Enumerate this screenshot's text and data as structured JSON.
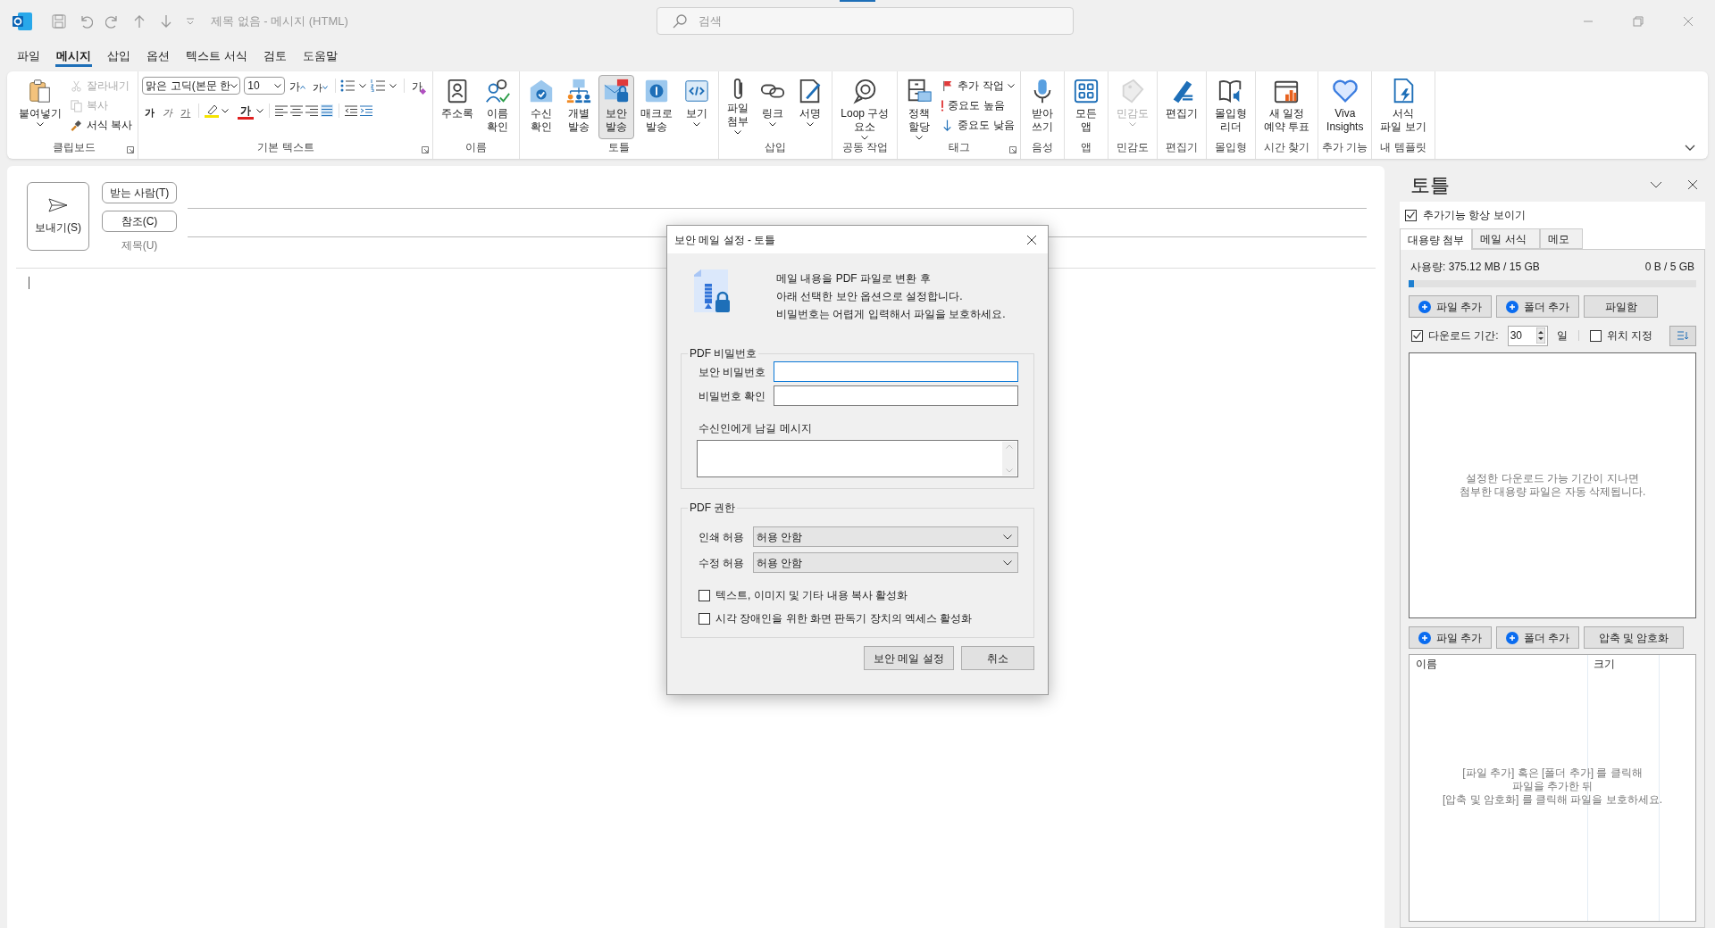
{
  "title_bar": {
    "title": "제목 없음  -  메시지 (HTML)",
    "search_placeholder": "검색"
  },
  "menu_tabs": [
    {
      "label": "파일",
      "selected": false
    },
    {
      "label": "메시지",
      "selected": true
    },
    {
      "label": "삽입",
      "selected": false
    },
    {
      "label": "옵션",
      "selected": false
    },
    {
      "label": "텍스트 서식",
      "selected": false
    },
    {
      "label": "검토",
      "selected": false
    },
    {
      "label": "도움말",
      "selected": false
    }
  ],
  "ribbon": {
    "groups": [
      {
        "label": "클립보드",
        "launcher": true,
        "items": [
          {
            "kind": "large",
            "label": "붙여넣기",
            "dropdown": true,
            "disabled": false,
            "selected": false
          },
          {
            "kind": "stack",
            "items": [
              {
                "label": "잘라내기",
                "disabled": true,
                "dropdown": false
              },
              {
                "label": "복사",
                "disabled": true,
                "dropdown": false
              },
              {
                "label": "서식 복사",
                "disabled": false,
                "dropdown": false
              }
            ]
          }
        ]
      },
      {
        "label": "기본 텍스트",
        "launcher": true,
        "items": [
          {
            "kind": "text_tools",
            "font": "맑은 고딕(본문 한",
            "size": "10",
            "glyphs": [
              {
                "kind": "grow",
                "label": "가"
              },
              {
                "kind": "shrink",
                "label": "가"
              },
              {
                "kind": "clear",
                "label": "가"
              },
              {
                "kind": "bold",
                "label": "가"
              },
              {
                "kind": "italic",
                "label": "가"
              },
              {
                "kind": "underline",
                "label": "가"
              },
              {
                "kind": "font_color",
                "label": "가"
              }
            ]
          }
        ]
      },
      {
        "label": "이름",
        "launcher": false,
        "items": [
          {
            "kind": "large",
            "label": "주소록",
            "dropdown": false,
            "disabled": false,
            "selected": false
          },
          {
            "kind": "large",
            "label": "이름\n확인",
            "dropdown": false,
            "disabled": false,
            "selected": false
          }
        ]
      },
      {
        "label": "토틀",
        "launcher": false,
        "items": [
          {
            "kind": "large",
            "label": "수신\n확인",
            "dropdown": false,
            "disabled": false,
            "selected": false
          },
          {
            "kind": "large",
            "label": "개별\n발송",
            "dropdown": false,
            "disabled": false,
            "selected": false
          },
          {
            "kind": "large",
            "label": "보안\n발송",
            "dropdown": false,
            "disabled": false,
            "selected": true
          },
          {
            "kind": "large",
            "label": "매크로\n발송",
            "dropdown": false,
            "disabled": false,
            "selected": false
          },
          {
            "kind": "large",
            "label": "보기",
            "dropdown": true,
            "disabled": false,
            "selected": false
          }
        ]
      },
      {
        "label": "삽입",
        "launcher": false,
        "items": [
          {
            "kind": "large",
            "label": "파일\n첨부",
            "dropdown": true,
            "disabled": false,
            "selected": false
          },
          {
            "kind": "large",
            "label": "링크",
            "dropdown": true,
            "disabled": false,
            "selected": false
          },
          {
            "kind": "large",
            "label": "서명",
            "dropdown": true,
            "disabled": false,
            "selected": false
          }
        ]
      },
      {
        "label": "공동 작업",
        "launcher": false,
        "items": [
          {
            "kind": "large",
            "label": "Loop 구성\n요소",
            "dropdown": true,
            "disabled": false,
            "selected": false
          }
        ]
      },
      {
        "label": "태그",
        "launcher": true,
        "items": [
          {
            "kind": "large",
            "label": "정책\n할당",
            "dropdown": true,
            "disabled": false,
            "selected": false
          },
          {
            "kind": "stack",
            "items": [
              {
                "label": "추가 작업",
                "disabled": false,
                "dropdown": true
              },
              {
                "label": "중요도 높음",
                "disabled": false,
                "dropdown": false
              },
              {
                "label": "중요도 낮음",
                "disabled": false,
                "dropdown": false
              }
            ]
          }
        ]
      },
      {
        "label": "음성",
        "launcher": false,
        "items": [
          {
            "kind": "large",
            "label": "받아\n쓰기",
            "dropdown": false,
            "disabled": false,
            "selected": false
          }
        ]
      },
      {
        "label": "앱",
        "launcher": false,
        "items": [
          {
            "kind": "large",
            "label": "모든\n앱",
            "dropdown": false,
            "disabled": false,
            "selected": false
          }
        ]
      },
      {
        "label": "민감도",
        "launcher": false,
        "items": [
          {
            "kind": "large",
            "label": "민감도",
            "dropdown": true,
            "disabled": true,
            "selected": false
          }
        ]
      },
      {
        "label": "편집기",
        "launcher": false,
        "items": [
          {
            "kind": "large",
            "label": "편집기",
            "dropdown": false,
            "disabled": false,
            "selected": false
          }
        ]
      },
      {
        "label": "몰입형",
        "launcher": false,
        "items": [
          {
            "kind": "large",
            "label": "몰입형\n리더",
            "dropdown": false,
            "disabled": false,
            "selected": false
          }
        ]
      },
      {
        "label": "시간 찾기",
        "launcher": false,
        "items": [
          {
            "kind": "large",
            "label": "새 일정\n예약 투표",
            "dropdown": false,
            "disabled": false,
            "selected": false
          }
        ]
      },
      {
        "label": "추가 기능",
        "launcher": false,
        "items": [
          {
            "kind": "large",
            "label": "Viva\nInsights",
            "dropdown": false,
            "disabled": false,
            "selected": false
          }
        ]
      },
      {
        "label": "내 템플릿",
        "launcher": false,
        "items": [
          {
            "kind": "large",
            "label": "서식\n파일 보기",
            "dropdown": false,
            "disabled": false,
            "selected": false
          }
        ]
      }
    ]
  },
  "compose": {
    "send": "보내기(S)",
    "to": "받는 사람(T)",
    "cc": "참조(C)",
    "subject": "제목(U)"
  },
  "dialog": {
    "title": "보안 메일 설정 - 토틀",
    "description": "메일 내용을 PDF 파일로 변환 후\n아래 선택한 보안 옵션으로 설정합니다.\n비밀번호는 어렵게 입력해서 파일을 보호하세요.",
    "password_group": {
      "legend": "PDF 비밀번호",
      "fields": [
        {
          "label": "보안 비밀번호",
          "focused": true
        },
        {
          "label": "비밀번호 확인",
          "focused": false
        }
      ],
      "message_label": "수신인에게 남길 메시지"
    },
    "permission_group": {
      "legend": "PDF 권한",
      "selects": [
        {
          "label": "인쇄 허용",
          "value": "허용 안함"
        },
        {
          "label": "수정 허용",
          "value": "허용 안함"
        }
      ],
      "checkboxes": [
        {
          "label": "텍스트, 이미지 및 기타 내용 복사 활성화",
          "checked": false
        },
        {
          "label": "시각 장애인을 위한 화면 판독기 장치의 엑세스 활성화",
          "checked": false
        }
      ]
    },
    "buttons": [
      "보안 메일 설정",
      "취소"
    ]
  },
  "side_pane": {
    "title": "토틀",
    "always_show": {
      "label": "추가기능 항상 보이기",
      "checked": true
    },
    "tabs": [
      {
        "label": "대용량 첨부",
        "selected": true
      },
      {
        "label": "메일 서식",
        "selected": false
      },
      {
        "label": "메모",
        "selected": false
      }
    ],
    "usage": "사용량: 375.12 MB / 15 GB",
    "quota": "0 B / 5 GB",
    "level": 0.02,
    "top_buttons": [
      {
        "kind": "add",
        "label": "파일 추가"
      },
      {
        "kind": "add",
        "label": "폴더 추가"
      },
      {
        "kind": "plain",
        "label": "파일함"
      }
    ],
    "period": {
      "label": "다운로드 기간:",
      "checked": true,
      "value": "30",
      "unit": "일"
    },
    "location": {
      "label": "위치 지정",
      "checked": false
    },
    "upload_hint": "설정한 다운로드 가능 기간이 지나면\n첨부한 대용량 파일은 자동 삭제됩니다.",
    "bottom_buttons": [
      {
        "kind": "add",
        "label": "파일 추가"
      },
      {
        "kind": "add",
        "label": "폴더 추가"
      },
      {
        "kind": "plain",
        "label": "압축 및 암호화"
      }
    ],
    "columns": [
      "이름",
      "크기"
    ],
    "list_hint": "[파일 추가] 혹은 [폴더 추가] 를 클릭해\n파일을 추가한 뒤\n[압축 및 암호화] 를 클릭해 파일을 보호하세요."
  }
}
